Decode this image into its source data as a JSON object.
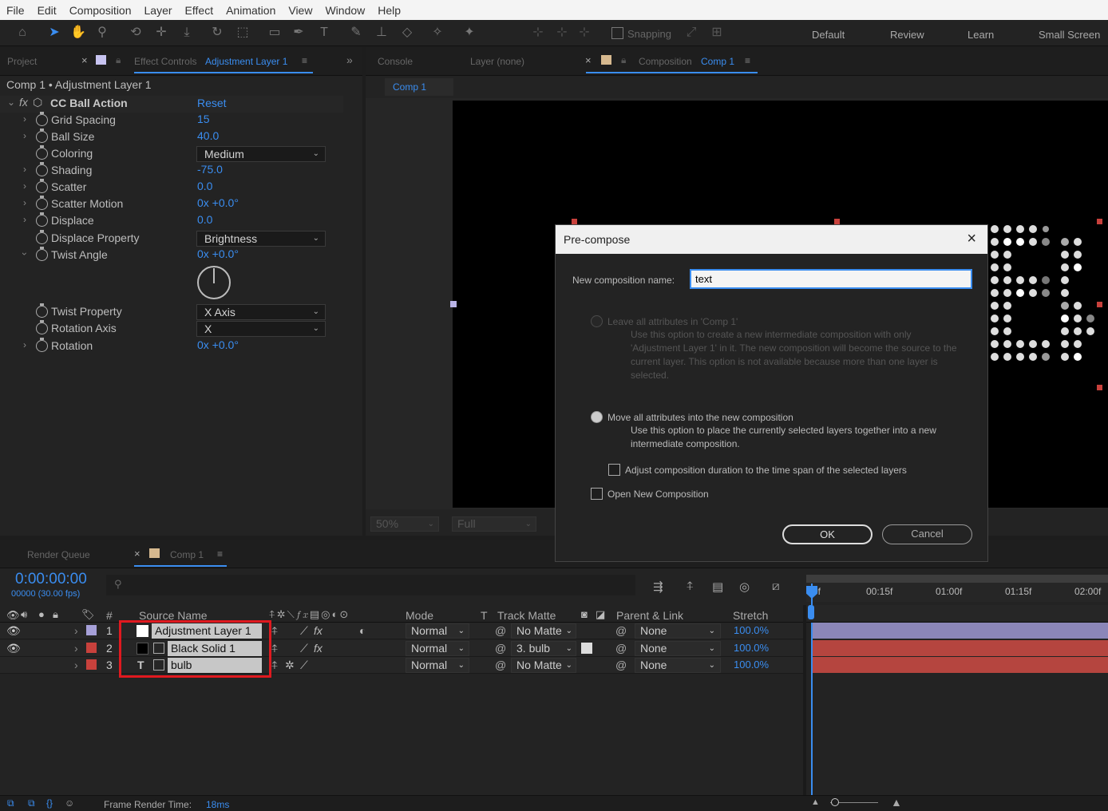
{
  "menu": [
    "File",
    "Edit",
    "Composition",
    "Layer",
    "Effect",
    "Animation",
    "View",
    "Window",
    "Help"
  ],
  "toolbar": {
    "snapping": "Snapping",
    "workspaces": [
      "Default",
      "Review",
      "Learn",
      "Small Screen"
    ]
  },
  "left_panel": {
    "tab_project": "Project",
    "tab_effect_controls": "Effect Controls",
    "tab_effect_layer": "Adjustment Layer 1",
    "breadcrumb": "Comp 1 • Adjustment Layer 1",
    "effect_name": "CC Ball Action",
    "reset": "Reset",
    "props": [
      {
        "name": "Grid Spacing",
        "value": "15"
      },
      {
        "name": "Ball Size",
        "value": "40.0"
      },
      {
        "name": "Coloring",
        "value": "Medium"
      },
      {
        "name": "Shading",
        "value": "-75.0"
      },
      {
        "name": "Scatter",
        "value": "0.0"
      },
      {
        "name": "Scatter Motion",
        "value": "0x +0.0°"
      },
      {
        "name": "Displace",
        "value": "0.0"
      },
      {
        "name": "Displace Property",
        "value": "Brightness"
      },
      {
        "name": "Twist Angle",
        "value": "0x +0.0°"
      },
      {
        "name": "Twist Property",
        "value": "X Axis"
      },
      {
        "name": "Rotation Axis",
        "value": "X"
      },
      {
        "name": "Rotation",
        "value": "0x +0.0°"
      }
    ]
  },
  "viewer": {
    "tab_console": "Console",
    "tab_layer": "Layer (none)",
    "tab_composition": "Composition",
    "tab_comp_name": "Comp 1",
    "subtab": "Comp 1",
    "zoom": "50%",
    "resolution": "Full"
  },
  "dialog": {
    "title": "Pre-compose",
    "name_label": "New composition name:",
    "name_value": "text",
    "opt1_label": "Leave all attributes in 'Comp 1'",
    "opt1_desc": "Use this option to create a new intermediate composition with only 'Adjustment Layer 1' in it. The new composition will become the source to the current layer. This option is not available because more than one layer is selected.",
    "opt2_label": "Move all attributes into the new composition",
    "opt2_desc": "Use this option to place the currently selected layers together into a new intermediate composition.",
    "adjust_duration": "Adjust composition duration to the time span of the selected layers",
    "open_new": "Open New Composition",
    "ok": "OK",
    "cancel": "Cancel"
  },
  "timeline": {
    "tab_render": "Render Queue",
    "tab_comp": "Comp 1",
    "timecode": "0:00:00:00",
    "frames": "00000 (30.00 fps)",
    "headers": {
      "num": "#",
      "source": "Source Name",
      "mode": "Mode",
      "t": "T",
      "track": "Track Matte",
      "parent": "Parent & Link",
      "stretch": "Stretch"
    },
    "ruler": [
      "0f",
      "00:15f",
      "01:00f",
      "01:15f",
      "02:00f"
    ],
    "layers": [
      {
        "num": "1",
        "name": "Adjustment Layer 1",
        "mode": "Normal",
        "matte": "No Matte",
        "parent": "None",
        "stretch": "100.0%",
        "label_color": "#a6a0d8",
        "swatch": "#ffffff"
      },
      {
        "num": "2",
        "name": "Black Solid 1",
        "mode": "Normal",
        "matte": "3. bulb",
        "parent": "None",
        "stretch": "100.0%",
        "label_color": "#c8413c",
        "swatch": "#000000"
      },
      {
        "num": "3",
        "name": "bulb",
        "mode": "Normal",
        "matte": "No Matte",
        "parent": "None",
        "stretch": "100.0%",
        "label_color": "#c8413c",
        "swatch": "T"
      }
    ],
    "frame_render_label": "Frame Render Time:",
    "frame_render_value": "18ms"
  }
}
